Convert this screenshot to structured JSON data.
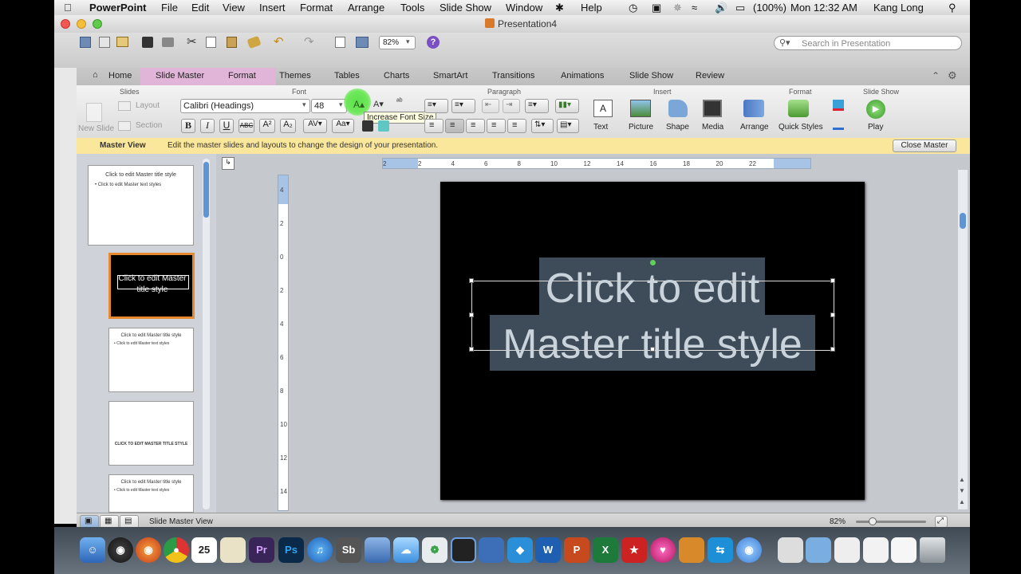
{
  "menubar": {
    "app": "PowerPoint",
    "items": [
      "File",
      "Edit",
      "View",
      "Insert",
      "Format",
      "Arrange",
      "Tools",
      "Slide Show",
      "Window",
      "Help"
    ],
    "battery": "(100%)",
    "clock": "Mon 12:32 AM",
    "user": "Kang Long"
  },
  "window": {
    "title": "Presentation4"
  },
  "toolbar": {
    "zoom": "82%",
    "search_placeholder": "Search in Presentation"
  },
  "ribbon_tabs": [
    "Home",
    "Slide Master",
    "Format",
    "Themes",
    "Tables",
    "Charts",
    "SmartArt",
    "Transitions",
    "Animations",
    "Slide Show",
    "Review"
  ],
  "ribbon": {
    "groups": {
      "slides": "Slides",
      "font": "Font",
      "paragraph": "Paragraph",
      "insert": "Insert",
      "format": "Format",
      "slide_show": "Slide Show"
    },
    "new_slide": "New Slide",
    "layout": "Layout",
    "section": "Section",
    "font_name": "Calibri (Headings)",
    "font_size": "48",
    "tooltip": "Increase Font Size",
    "insert_items": [
      "Text",
      "Picture",
      "Shape",
      "Media"
    ],
    "arrange": "Arrange",
    "quick_styles": "Quick Styles",
    "play": "Play"
  },
  "message_bar": {
    "title": "Master View",
    "text": "Edit the master slides and layouts to change the design of your presentation.",
    "close": "Close Master"
  },
  "ruler_numbers": [
    "2",
    "2",
    "4",
    "6",
    "8",
    "10",
    "12",
    "14",
    "16",
    "18",
    "20",
    "22"
  ],
  "vruler_numbers": [
    "4",
    "2",
    "0",
    "2",
    "4",
    "6",
    "8",
    "10",
    "12",
    "14"
  ],
  "thumbnails": [
    {
      "title": "Click to edit Master title style",
      "body": "• Click to edit Master text styles"
    },
    {
      "title": "Click to edit Master title style",
      "body": ""
    },
    {
      "title": "Click to edit Master title style",
      "body": "• Click to edit Master text styles"
    },
    {
      "title": "CLICK TO EDIT MASTER TITLE STYLE",
      "body": ""
    },
    {
      "title": "Click to edit Master title style",
      "body": "• Click to edit Master text styles"
    }
  ],
  "slide": {
    "line1": "Click to edit",
    "line2": "Master title style"
  },
  "statusbar": {
    "view_label": "Slide Master View",
    "zoom": "82%"
  },
  "dock": {
    "labels": [
      "25",
      "Pr",
      "Ps",
      "Sb",
      "W",
      "P",
      "X"
    ]
  }
}
